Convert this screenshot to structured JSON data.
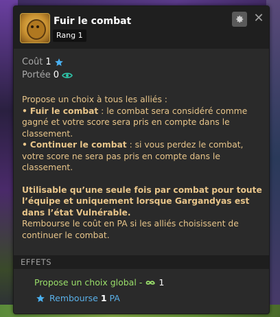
{
  "spell": {
    "title": "Fuir le combat",
    "rank": "Rang 1"
  },
  "header_buttons": {
    "settings": "gear-icon",
    "close": "✕"
  },
  "stats": {
    "cost_label": "Coût",
    "cost_value": "1",
    "range_label": "Portée",
    "range_value": "0"
  },
  "description": {
    "intro": "Propose un choix à tous les alliés :",
    "bullet": "•",
    "option1_title": "Fuir le combat",
    "option1_text": " : le combat sera considéré comme gagné et votre score sera pris en compte dans le classement.",
    "option2_title": "Continuer le combat",
    "option2_text": " : si vous perdez le combat, votre score ne sera pas pris en compte dans le classement.",
    "usage": "Utilisable qu’une seule fois par combat pour toute l’équipe et uniquement lorsque Gargandyas est dans l’état Vulnérable.",
    "refund": "Rembourse le coût en PA si les alliés choisissent de continuer le combat."
  },
  "effects": {
    "header": "EFFETS",
    "effect1_text": "Propose un choix global",
    "effect1_sep": "-",
    "effect1_value": "1",
    "effect2_label": "Rembourse",
    "effect2_value": "1",
    "effect2_unit": "PA"
  },
  "colors": {
    "accent_text": "#e8c58a",
    "effect_green": "#9adf6a",
    "effect_blue": "#5ab0e8",
    "star_blue": "#4ab0f0",
    "eye_teal": "#2ec4a8"
  }
}
